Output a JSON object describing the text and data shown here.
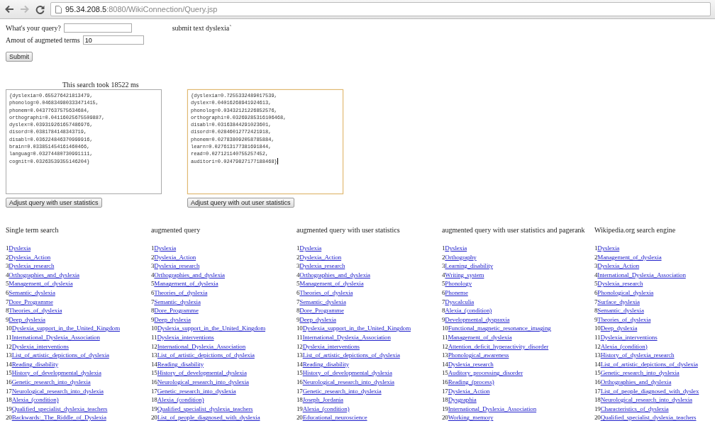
{
  "browser": {
    "url_host": "95.34.208.5",
    "url_path": ":8080/WikiConnection/Query.jsp"
  },
  "form": {
    "query_label": "What's your query?",
    "terms_label": "Amout of augmeted terms",
    "terms_value": "10",
    "submit": "Submit",
    "submitted_text": "submit text dyslexia`"
  },
  "timing": "This search took 18522 ms",
  "outputs": [
    {
      "focused": false,
      "lines": [
        "{dyslexia=0.655276421813479,",
        "phonolog=0.046834980333471415,",
        "phonem=0.04377637575634684,",
        "orthographi=0.04116025675509887,",
        "dyslex=0.039319261657486976,",
        "disord=0.0381784148343719,",
        "disabl=0.036224846370999916,",
        "brain=0.033851454161460466,",
        "languag=0.03274480730991111,",
        "cognit=0.03263539355146204}"
      ],
      "button": "Adjust query with user statistics"
    },
    {
      "focused": true,
      "lines": [
        "{dyslexia=0.7255332489017539,",
        "dyslex=0.04016268941924613,",
        "phonolog=0.03432121226852576,",
        "orthographi=0.03269285316106468,",
        "disabl=0.03163844291023601,",
        "disord=0.02846012772421918,",
        "phonem=0.027838092058785884,",
        "learn=0.027613177381691844,",
        "read=0.027121140755257452,",
        "auditori=0.02479827177188468}"
      ],
      "button": "Adjust query with out user statistics"
    }
  ],
  "result_columns": [
    {
      "heading": "Single term search",
      "items": [
        {
          "rank": "1",
          "title": "Dyslexia"
        },
        {
          "rank": "2",
          "title": "Dyslexia_Action"
        },
        {
          "rank": "3",
          "title": "Dyslexia_research"
        },
        {
          "rank": "4",
          "title": "Orthographies_and_dyslexia"
        },
        {
          "rank": "5",
          "title": "Management_of_dyslexia"
        },
        {
          "rank": "6",
          "title": "Semantic_dyslexia"
        },
        {
          "rank": "7",
          "title": "Dore_Programme"
        },
        {
          "rank": "8",
          "title": "Theories_of_dyslexia"
        },
        {
          "rank": "9",
          "title": "Deep_dyslexia"
        },
        {
          "rank": "10",
          "title": "Dyslexia_support_in_the_United_Kingdom"
        },
        {
          "rank": "11",
          "title": "International_Dyslexia_Association"
        },
        {
          "rank": "12",
          "title": "Dyslexia_interventions"
        },
        {
          "rank": "13",
          "title": "List_of_artistic_depictions_of_dyslexia"
        },
        {
          "rank": "14",
          "title": "Reading_disability"
        },
        {
          "rank": "15",
          "title": "History_of_developmental_dyslexia"
        },
        {
          "rank": "16",
          "title": "Genetic_research_into_dyslexia"
        },
        {
          "rank": "17",
          "title": "Neurological_research_into_dyslexia"
        },
        {
          "rank": "18",
          "title": "Alexia_(condition)"
        },
        {
          "rank": "19",
          "title": "Qualified_specialist_dyslexia_teachers"
        },
        {
          "rank": "20",
          "title": "Backwards:_The_Riddle_of_Dyslexia"
        }
      ]
    },
    {
      "heading": "augmented query",
      "items": [
        {
          "rank": "1",
          "title": "Dyslexia"
        },
        {
          "rank": "2",
          "title": "Dyslexia_Action"
        },
        {
          "rank": "3",
          "title": "Dyslexia_research"
        },
        {
          "rank": "4",
          "title": "Orthographies_and_dyslexia"
        },
        {
          "rank": "5",
          "title": "Management_of_dyslexia"
        },
        {
          "rank": "6",
          "title": "Theories_of_dyslexia"
        },
        {
          "rank": "7",
          "title": "Semantic_dyslexia"
        },
        {
          "rank": "8",
          "title": "Dore_Programme"
        },
        {
          "rank": "9",
          "title": "Deep_dyslexia"
        },
        {
          "rank": "10",
          "title": "Dyslexia_support_in_the_United_Kingdom"
        },
        {
          "rank": "11",
          "title": "Dyslexia_interventions"
        },
        {
          "rank": "12",
          "title": "International_Dyslexia_Association"
        },
        {
          "rank": "13",
          "title": "List_of_artistic_depictions_of_dyslexia"
        },
        {
          "rank": "14",
          "title": "Reading_disability"
        },
        {
          "rank": "15",
          "title": "History_of_developmental_dyslexia"
        },
        {
          "rank": "16",
          "title": "Neurological_research_into_dyslexia"
        },
        {
          "rank": "17",
          "title": "Genetic_research_into_dyslexia"
        },
        {
          "rank": "18",
          "title": "Alexia_(condition)"
        },
        {
          "rank": "19",
          "title": "Qualified_specialist_dyslexia_teachers"
        },
        {
          "rank": "20",
          "title": "List_of_people_diagnosed_with_dyslexia"
        }
      ]
    },
    {
      "heading": "augmented query with user statistics",
      "items": [
        {
          "rank": "1",
          "title": "Dyslexia"
        },
        {
          "rank": "2",
          "title": "Dyslexia_Action"
        },
        {
          "rank": "3",
          "title": "Dyslexia_research"
        },
        {
          "rank": "4",
          "title": "Orthographies_and_dyslexia"
        },
        {
          "rank": "5",
          "title": "Management_of_dyslexia"
        },
        {
          "rank": "6",
          "title": "Theories_of_dyslexia"
        },
        {
          "rank": "7",
          "title": "Semantic_dyslexia"
        },
        {
          "rank": "8",
          "title": "Dore_Programme"
        },
        {
          "rank": "9",
          "title": "Deep_dyslexia"
        },
        {
          "rank": "10",
          "title": "Dyslexia_support_in_the_United_Kingdom"
        },
        {
          "rank": "11",
          "title": "International_Dyslexia_Association"
        },
        {
          "rank": "12",
          "title": "Dyslexia_interventions"
        },
        {
          "rank": "13",
          "title": "List_of_artistic_depictions_of_dyslexia"
        },
        {
          "rank": "14",
          "title": "Reading_disability"
        },
        {
          "rank": "15",
          "title": "History_of_developmental_dyslexia"
        },
        {
          "rank": "16",
          "title": "Neurological_research_into_dyslexia"
        },
        {
          "rank": "17",
          "title": "Genetic_research_into_dyslexia"
        },
        {
          "rank": "18",
          "title": "Joseph_Jordania"
        },
        {
          "rank": "19",
          "title": "Alexia_(condition)"
        },
        {
          "rank": "20",
          "title": "Educational_neuroscience"
        }
      ]
    },
    {
      "heading": "augmented query with user statistics and pagerank",
      "items": [
        {
          "rank": "1",
          "title": "Dyslexia"
        },
        {
          "rank": "2",
          "title": "Orthography"
        },
        {
          "rank": "3",
          "title": "Learning_disability"
        },
        {
          "rank": "4",
          "title": "Writing_system"
        },
        {
          "rank": "5",
          "title": "Phonology"
        },
        {
          "rank": "6",
          "title": "Phoneme"
        },
        {
          "rank": "7",
          "title": "Dyscalculia"
        },
        {
          "rank": "8",
          "title": "Alexia_(condition)"
        },
        {
          "rank": "9",
          "title": "Developmental_dyspraxia"
        },
        {
          "rank": "10",
          "title": "Functional_magnetic_resonance_imaging"
        },
        {
          "rank": "11",
          "title": "Management_of_dyslexia"
        },
        {
          "rank": "12",
          "title": "Attention_deficit_hyperactivity_disorder"
        },
        {
          "rank": "13",
          "title": "Phonological_awareness"
        },
        {
          "rank": "14",
          "title": "Dyslexia_research"
        },
        {
          "rank": "15",
          "title": "Auditory_processing_disorder"
        },
        {
          "rank": "16",
          "title": "Reading_(process)"
        },
        {
          "rank": "17",
          "title": "Dyslexia_Action"
        },
        {
          "rank": "18",
          "title": "Dysgraphia"
        },
        {
          "rank": "19",
          "title": "International_Dyslexia_Association"
        },
        {
          "rank": "20",
          "title": "Working_memory"
        }
      ]
    },
    {
      "heading": "Wikipedia.org search engine",
      "items": [
        {
          "rank": "1",
          "title": "Dyslexia"
        },
        {
          "rank": "2",
          "title": "Management_of_dyslexia"
        },
        {
          "rank": "3",
          "title": "Dyslexia_Action"
        },
        {
          "rank": "4",
          "title": "International_Dyslexia_Association"
        },
        {
          "rank": "5",
          "title": "Dyslexia_research"
        },
        {
          "rank": "6",
          "title": "Phonological_dyslexia"
        },
        {
          "rank": "7",
          "title": "Surface_dyslexia"
        },
        {
          "rank": "8",
          "title": "Semantic_dyslexia"
        },
        {
          "rank": "9",
          "title": "Theories_of_dyslexia"
        },
        {
          "rank": "10",
          "title": "Deep_dyslexia"
        },
        {
          "rank": "11",
          "title": "Dyslexia_interventions"
        },
        {
          "rank": "12",
          "title": "Alexia_(condition)"
        },
        {
          "rank": "13",
          "title": "History_of_dyslexia_research"
        },
        {
          "rank": "14",
          "title": "List_of_artistic_depictions_of_dyslexia"
        },
        {
          "rank": "15",
          "title": "Genetic_research_into_dyslexia"
        },
        {
          "rank": "16",
          "title": "Orthographies_and_dyslexia"
        },
        {
          "rank": "17",
          "title": "List_of_people_diagnosed_with_dyslex"
        },
        {
          "rank": "18",
          "title": "Neurological_research_into_dyslexia"
        },
        {
          "rank": "19",
          "title": "Characteristics_of_dyslexia"
        },
        {
          "rank": "20",
          "title": "Qualified_specialist_dyslexia_teachers"
        }
      ]
    }
  ]
}
